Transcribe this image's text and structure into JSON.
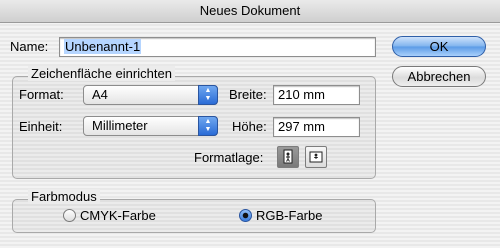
{
  "window": {
    "title": "Neues Dokument"
  },
  "name": {
    "label": "Name:",
    "value": "Unbenannt-1"
  },
  "buttons": {
    "ok": "OK",
    "cancel": "Abbrechen"
  },
  "artboard": {
    "title": "Zeichenfläche einrichten",
    "format_label": "Format:",
    "format_value": "A4",
    "unit_label": "Einheit:",
    "unit_value": "Millimeter",
    "width_label": "Breite:",
    "width_value": "210 mm",
    "height_label": "Höhe:",
    "height_value": "297 mm",
    "orientation_label": "Formatlage:",
    "orientation_selected": "portrait"
  },
  "colormode": {
    "title": "Farbmodus",
    "options": [
      {
        "label": "CMYK-Farbe",
        "checked": false
      },
      {
        "label": "RGB-Farbe",
        "checked": true
      }
    ]
  },
  "icons": {
    "popup_arrows": "up-down-arrows-icon",
    "portrait": "portrait-orientation-icon",
    "landscape": "landscape-orientation-icon"
  },
  "colors": {
    "accent": "#3b7ddc",
    "selection": "#b5d5ff"
  }
}
